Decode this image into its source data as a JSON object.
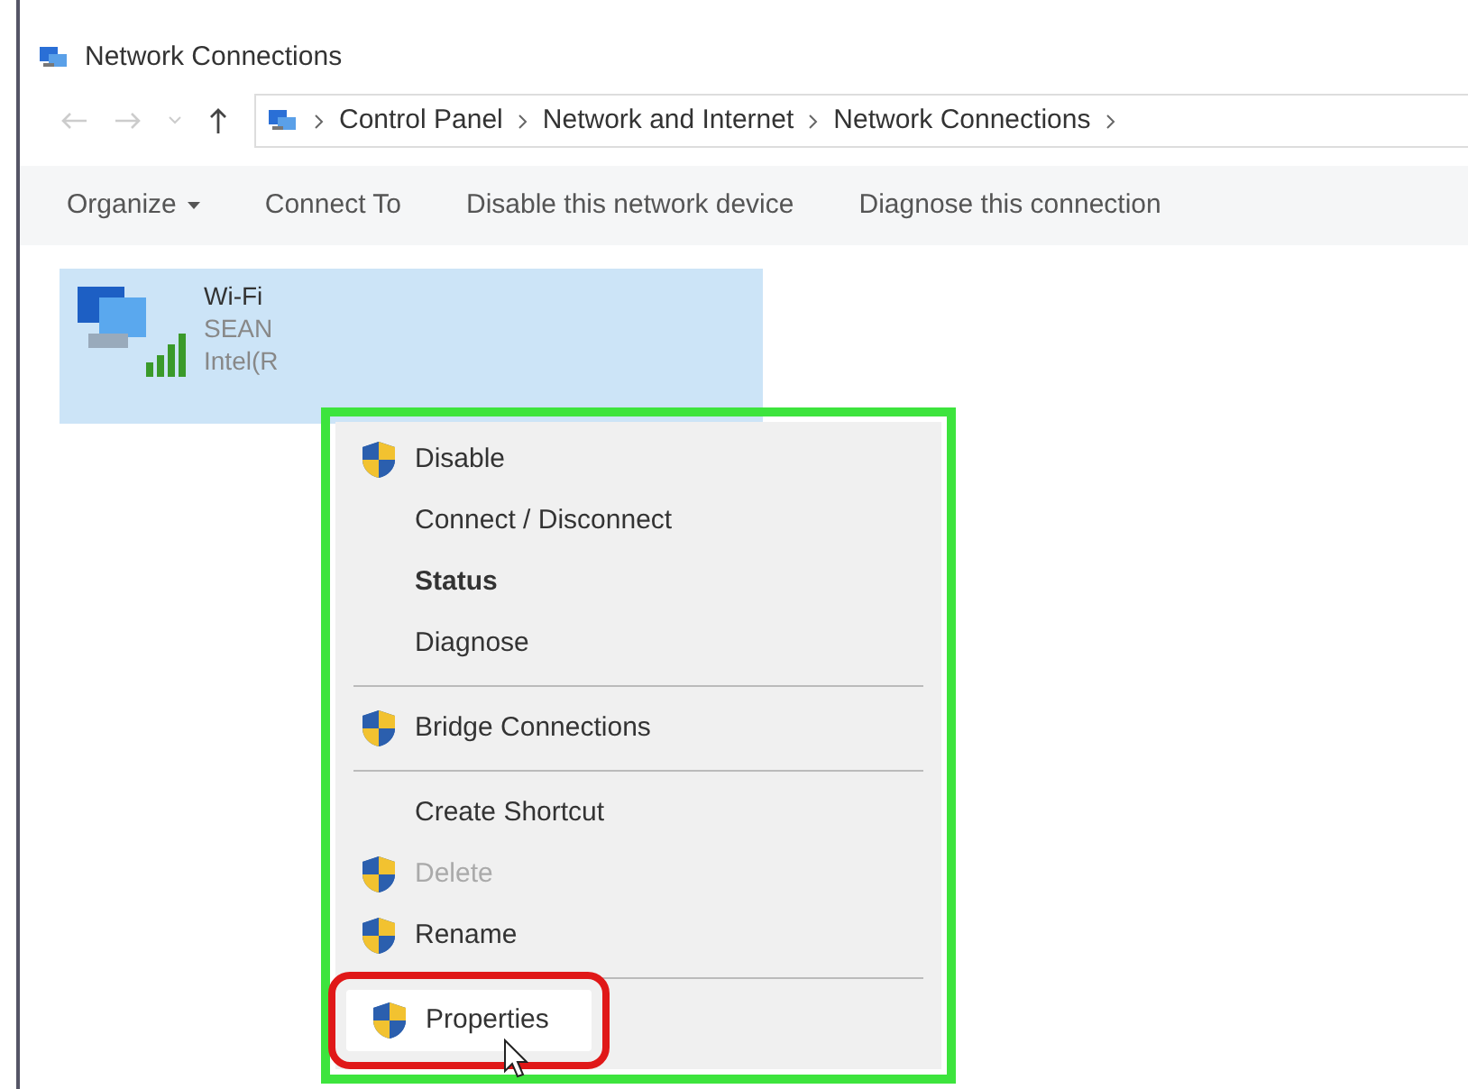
{
  "window": {
    "title": "Network Connections"
  },
  "address_bar": {
    "crumbs": [
      "Control Panel",
      "Network and Internet",
      "Network Connections"
    ]
  },
  "toolbar": [
    {
      "label": "Organize",
      "dropdown": true
    },
    {
      "label": "Connect To",
      "dropdown": false
    },
    {
      "label": "Disable this network device",
      "dropdown": false
    },
    {
      "label": "Diagnose this connection",
      "dropdown": false
    }
  ],
  "connection": {
    "name": "Wi-Fi",
    "network": "SEAN",
    "adapter": "Intel(R",
    "selected": true
  },
  "context_menu": {
    "framed": true,
    "items": [
      {
        "kind": "item",
        "label": "Disable",
        "shield": true,
        "bold": false,
        "disabled": false,
        "outlined": false
      },
      {
        "kind": "item",
        "label": "Connect / Disconnect",
        "shield": false,
        "bold": false,
        "disabled": false,
        "outlined": false
      },
      {
        "kind": "item",
        "label": "Status",
        "shield": false,
        "bold": true,
        "disabled": false,
        "outlined": false
      },
      {
        "kind": "item",
        "label": "Diagnose",
        "shield": false,
        "bold": false,
        "disabled": false,
        "outlined": false
      },
      {
        "kind": "separator"
      },
      {
        "kind": "item",
        "label": "Bridge Connections",
        "shield": true,
        "bold": false,
        "disabled": false,
        "outlined": false
      },
      {
        "kind": "separator"
      },
      {
        "kind": "item",
        "label": "Create Shortcut",
        "shield": false,
        "bold": false,
        "disabled": false,
        "outlined": false
      },
      {
        "kind": "item",
        "label": "Delete",
        "shield": true,
        "bold": false,
        "disabled": true,
        "outlined": false
      },
      {
        "kind": "item",
        "label": "Rename",
        "shield": true,
        "bold": false,
        "disabled": false,
        "outlined": false
      },
      {
        "kind": "separator"
      },
      {
        "kind": "item",
        "label": "Properties",
        "shield": true,
        "bold": false,
        "disabled": false,
        "outlined": true
      }
    ]
  }
}
